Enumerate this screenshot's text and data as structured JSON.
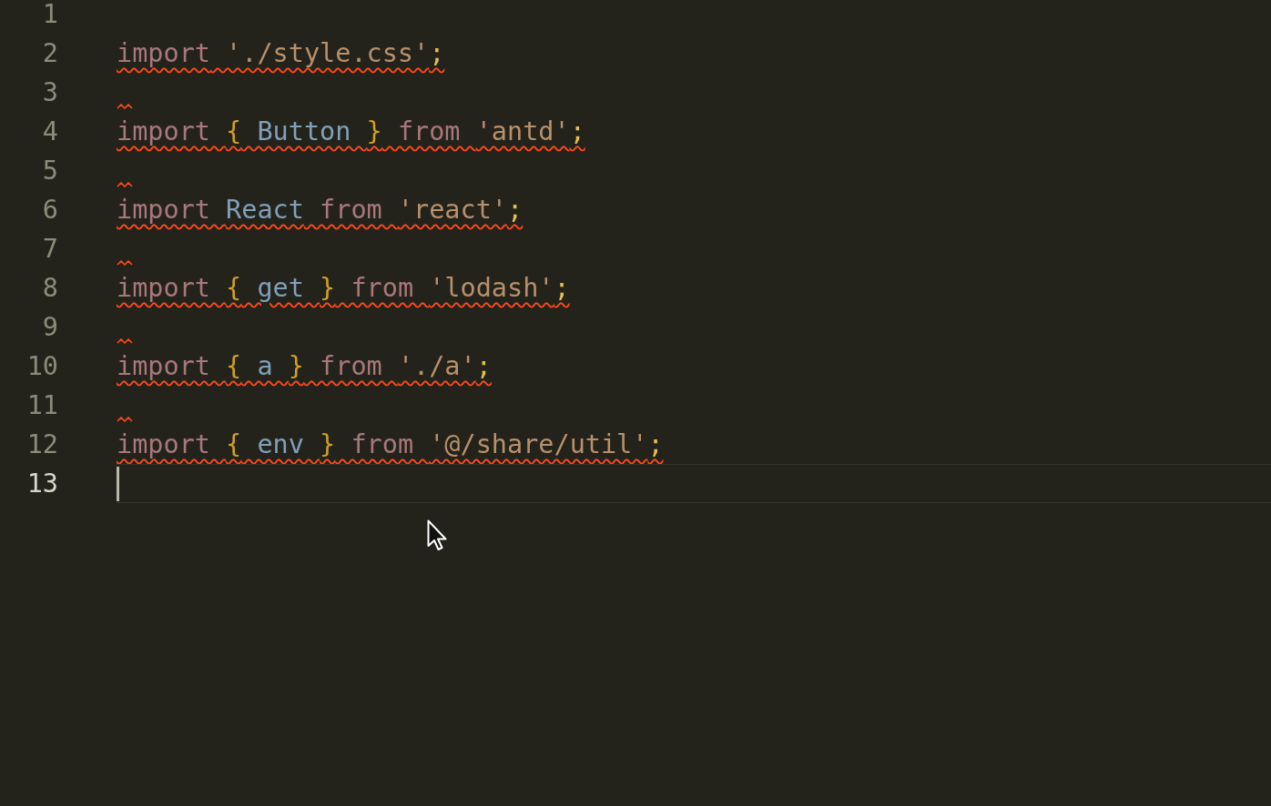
{
  "editor": {
    "lines": [
      {
        "number": "1",
        "error": false,
        "current": false
      },
      {
        "number": "2",
        "tokens": [
          {
            "text": "import",
            "kind": "keyword"
          },
          {
            "text": " './style.css'",
            "kind": "string"
          },
          {
            "text": ";",
            "kind": "punct"
          }
        ],
        "error": true,
        "current": false
      },
      {
        "number": "3",
        "error": true,
        "current": false
      },
      {
        "number": "4",
        "tokens": [
          {
            "text": "import ",
            "kind": "keyword"
          },
          {
            "text": "{",
            "kind": "brace"
          },
          {
            "text": " Button ",
            "kind": "ident"
          },
          {
            "text": "}",
            "kind": "brace"
          },
          {
            "text": " from ",
            "kind": "keyword"
          },
          {
            "text": "'antd'",
            "kind": "string"
          },
          {
            "text": ";",
            "kind": "punct"
          }
        ],
        "error": true,
        "current": false
      },
      {
        "number": "5",
        "error": true,
        "current": false
      },
      {
        "number": "6",
        "tokens": [
          {
            "text": "import ",
            "kind": "keyword"
          },
          {
            "text": "React",
            "kind": "ident"
          },
          {
            "text": " from ",
            "kind": "keyword"
          },
          {
            "text": "'react'",
            "kind": "string"
          },
          {
            "text": ";",
            "kind": "punct"
          }
        ],
        "error": true,
        "current": false
      },
      {
        "number": "7",
        "error": true,
        "current": false
      },
      {
        "number": "8",
        "tokens": [
          {
            "text": "import ",
            "kind": "keyword"
          },
          {
            "text": "{",
            "kind": "brace"
          },
          {
            "text": " get ",
            "kind": "ident"
          },
          {
            "text": "}",
            "kind": "brace"
          },
          {
            "text": " from ",
            "kind": "keyword"
          },
          {
            "text": "'lodash'",
            "kind": "string"
          },
          {
            "text": ";",
            "kind": "punct"
          }
        ],
        "error": true,
        "current": false
      },
      {
        "number": "9",
        "error": true,
        "current": false
      },
      {
        "number": "10",
        "tokens": [
          {
            "text": "import ",
            "kind": "keyword"
          },
          {
            "text": "{",
            "kind": "brace"
          },
          {
            "text": " a ",
            "kind": "ident"
          },
          {
            "text": "}",
            "kind": "brace"
          },
          {
            "text": " from ",
            "kind": "keyword"
          },
          {
            "text": "'./a'",
            "kind": "string"
          },
          {
            "text": ";",
            "kind": "punct"
          }
        ],
        "error": true,
        "current": false
      },
      {
        "number": "11",
        "error": true,
        "current": false
      },
      {
        "number": "12",
        "tokens": [
          {
            "text": "import ",
            "kind": "keyword"
          },
          {
            "text": "{",
            "kind": "brace"
          },
          {
            "text": " env ",
            "kind": "ident"
          },
          {
            "text": "}",
            "kind": "brace"
          },
          {
            "text": " from ",
            "kind": "keyword"
          },
          {
            "text": "'@/share/util'",
            "kind": "string"
          },
          {
            "text": ";",
            "kind": "punct"
          }
        ],
        "error": true,
        "current": false
      },
      {
        "number": "13",
        "error": false,
        "current": true
      }
    ]
  }
}
